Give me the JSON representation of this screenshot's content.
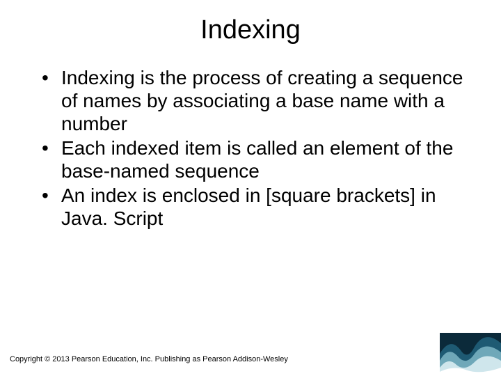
{
  "title": "Indexing",
  "bullets": [
    "Indexing is the process of creating a sequence of names by associating a base name with a number",
    "Each indexed item is called an element of the base-named sequence",
    "An index is enclosed in [square brackets] in Java. Script"
  ],
  "footer": "Copyright © 2013 Pearson Education, Inc. Publishing as Pearson Addison-Wesley"
}
